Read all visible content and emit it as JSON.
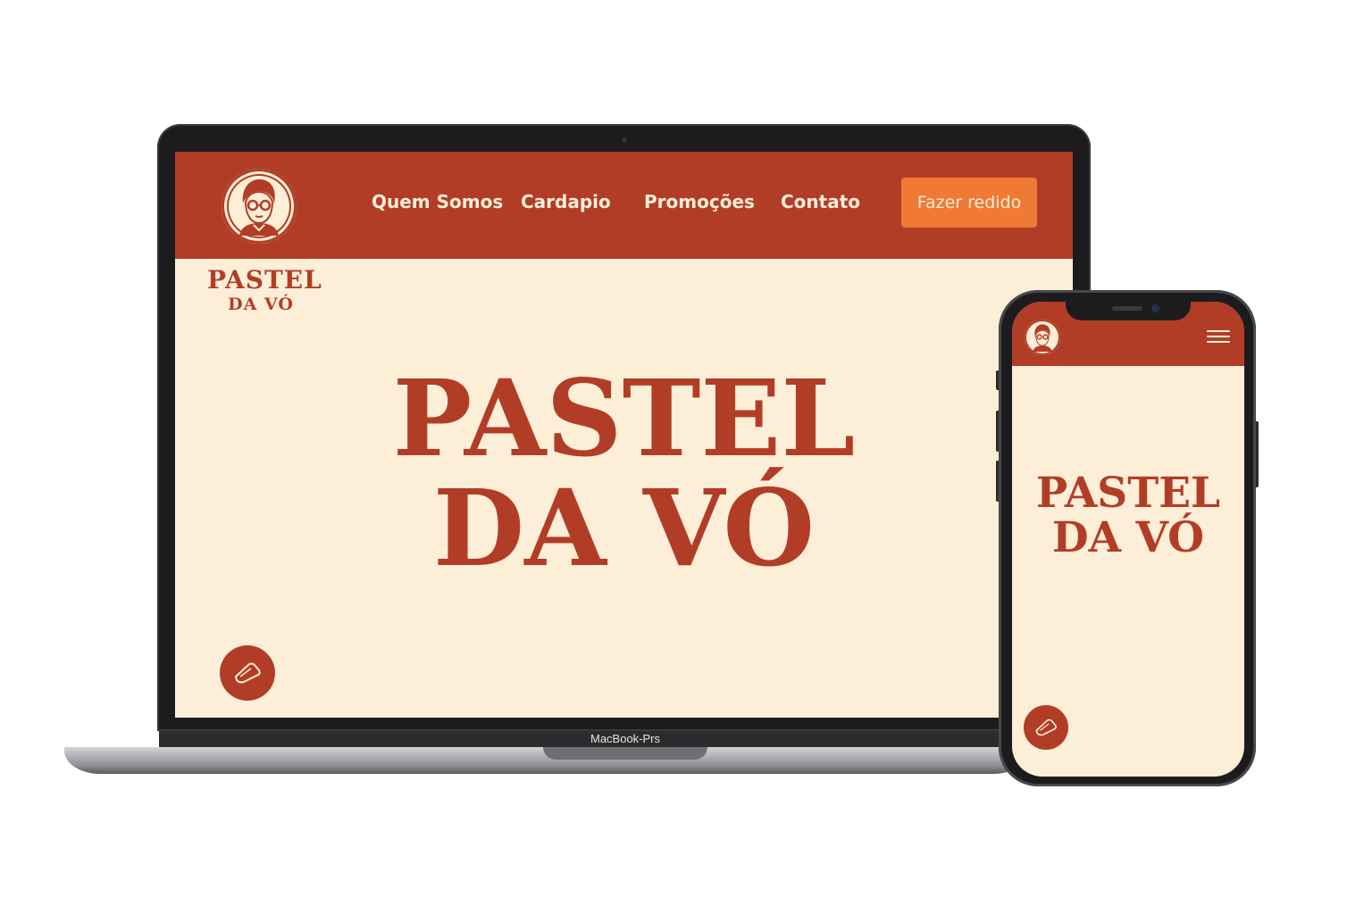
{
  "brand": {
    "name_line1": "PASTEL",
    "name_line2": "DA VÓ",
    "primary_color": "#b23d27",
    "background_color": "#fdeed7",
    "accent_color": "#f07a35",
    "logo_icon": "grandma-portrait-icon"
  },
  "desktop": {
    "nav": {
      "items": [
        "Quem Somos",
        "Cardapio",
        "Promoções",
        "Contato"
      ],
      "cta_label": "Fazer redido"
    },
    "hero": {
      "line1": "PASTEL",
      "line2": "DA VÓ"
    },
    "fab_icon": "pastry-icon"
  },
  "laptop": {
    "label": "MacBook-Prs"
  },
  "mobile": {
    "menu_icon": "hamburger-menu-icon",
    "hero": {
      "line1": "PASTEL",
      "line2": "DA VÓ"
    },
    "fab_icon": "pastry-icon"
  }
}
